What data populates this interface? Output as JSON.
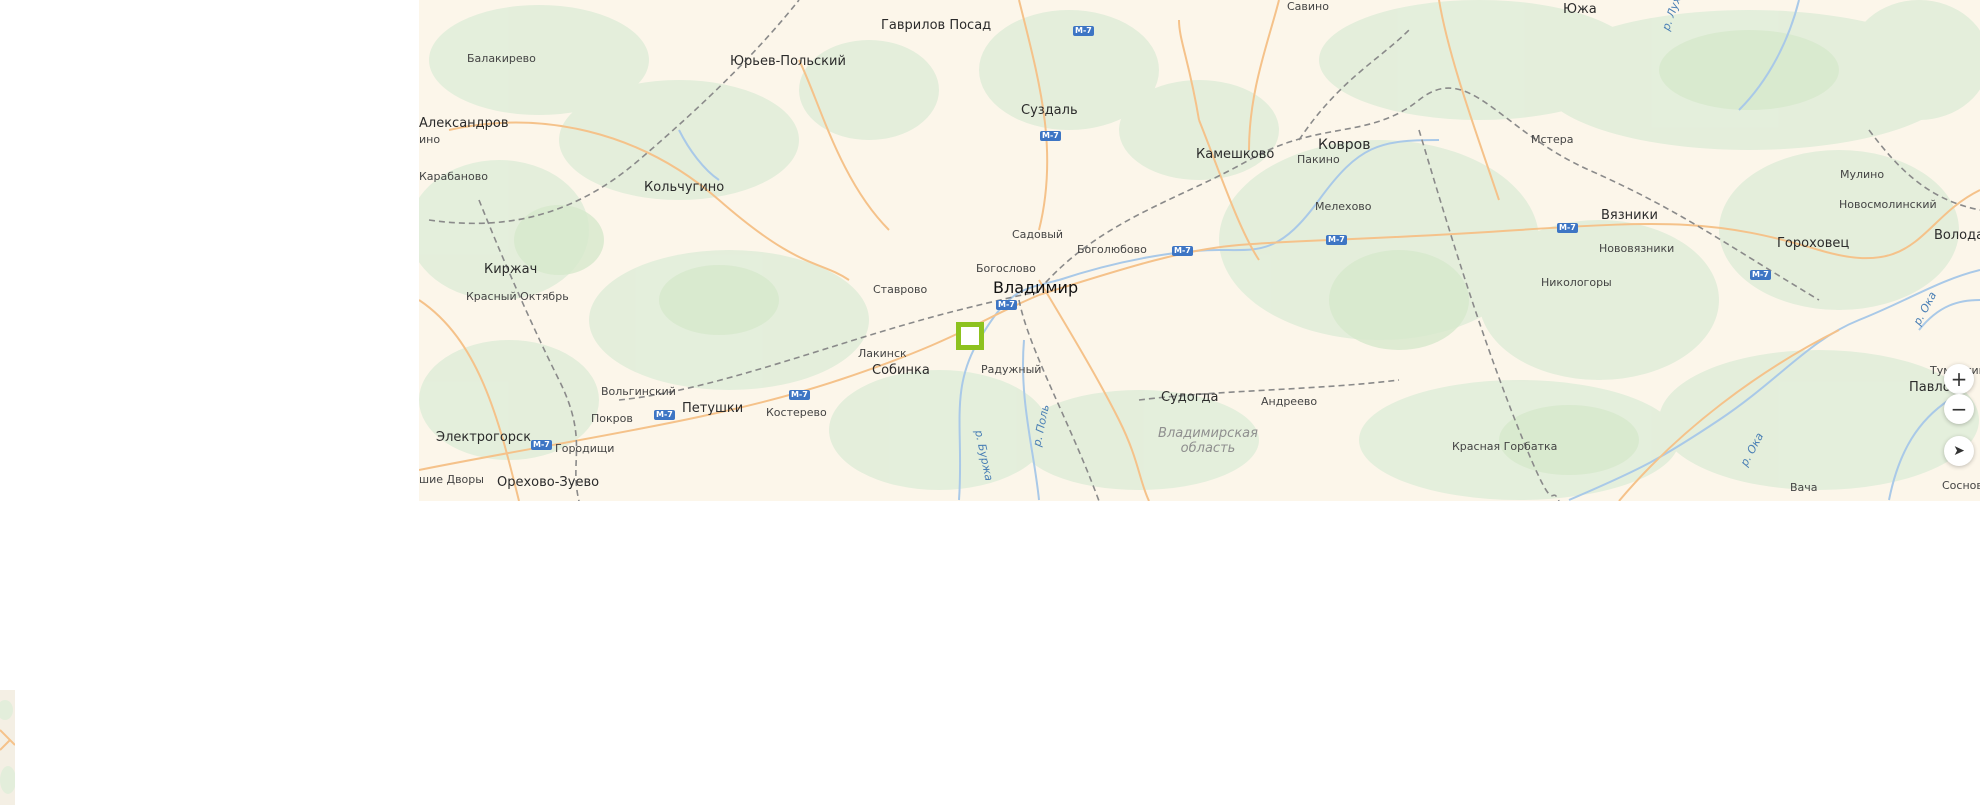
{
  "map": {
    "labels": {
      "gavrilov_posad": "Гаврилов Посад",
      "savino": "Савино",
      "yuzha": "Южа",
      "balakirevo": "Балакирево",
      "yuriev_polsky": "Юрьев-Польский",
      "suzdal": "Суздаль",
      "aleksandrov": "Александров",
      "kameshkovo": "Камешково",
      "kovrov": "Ковров",
      "pakino": "Пакино",
      "mstera": "Мстера",
      "karabanovo": "Карабаново",
      "kolchugino": "Кольчугино",
      "melekhovo": "Мелехово",
      "mulino": "Мулино",
      "novosmolinsky": "Новосмолинский",
      "vyazniki": "Вязники",
      "sadovy": "Садовый",
      "bogolyubovo": "Боголюбово",
      "gorokhovets": "Гороховец",
      "volodarsk": "Володарск",
      "novovyazniki": "Нововязники",
      "kirzhach": "Киржач",
      "bogoslovo": "Богослово",
      "stavrovo": "Ставрово",
      "vladimir": "Владимир",
      "nikologory": "Никологоры",
      "krasny_oktyabr": "Красный Октябрь",
      "lakinsk": "Лакинск",
      "sobinka": "Собинка",
      "raduzhny": "Радужный",
      "tumbotino": "Тумботино",
      "pavlovo": "Павлово",
      "volginsky": "Вольгинский",
      "sudogda": "Судогда",
      "andreevo": "Андреево",
      "petushki": "Петушки",
      "pokrov": "Покров",
      "kosterevo": "Костерево",
      "elektrogorsk": "Электрогорск",
      "gorodishchi": "Городищи",
      "krasnaya_gorbatka": "Красная Горбатка",
      "shie_dvory": "шие Дворы",
      "orekhovo_zuevo": "Орехово-Зуево",
      "vacha": "Вача",
      "sosnovskoe": "Сосновское",
      "ino": "ино"
    },
    "region_label": "Владимирская область",
    "rivers": {
      "buzha": "р. Буржа",
      "pol": "р. Поль",
      "oka1": "р. Ока",
      "oka2": "р. Ока",
      "luh": "р. Лух"
    },
    "road_shield": "M-7",
    "controls": {
      "zoom_in": "+",
      "zoom_out": "−",
      "locate": "➤"
    }
  }
}
